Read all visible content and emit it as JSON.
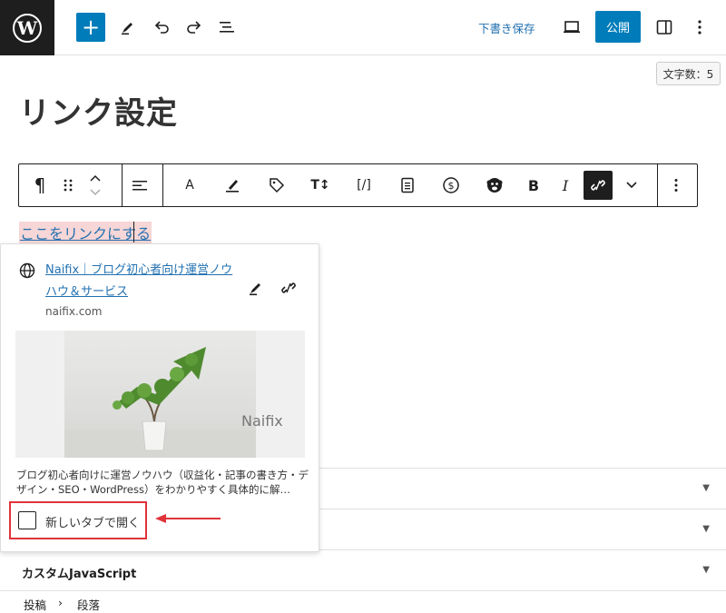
{
  "toolbar": {
    "save_draft": "下書き保存",
    "publish": "公開",
    "word_count": "文字数：5"
  },
  "post": {
    "title": "リンク設定",
    "link_text": "ここをリンクにする"
  },
  "link_popover": {
    "title": "Naifix｜ブログ初心者向け運営ノウハウ＆サービス",
    "domain": "naifix.com",
    "preview_watermark": "Naifix",
    "description": "ブログ初心者向けに運営ノウハウ（収益化・記事の書き方・デザイン・SEO・WordPress）をわかりやすく具体的に解…",
    "open_new_tab_label": "新しいタブで開く",
    "open_new_tab_checked": false
  },
  "panels": {
    "custom_js_label": "カスタムJavaScript"
  },
  "breadcrumb": {
    "items": [
      "投稿",
      "段落"
    ],
    "separator": "›"
  },
  "colors": {
    "accent": "#007cba",
    "link": "#2271b1",
    "annotation": "#e0333a",
    "highlight": "#f6d6d6"
  }
}
